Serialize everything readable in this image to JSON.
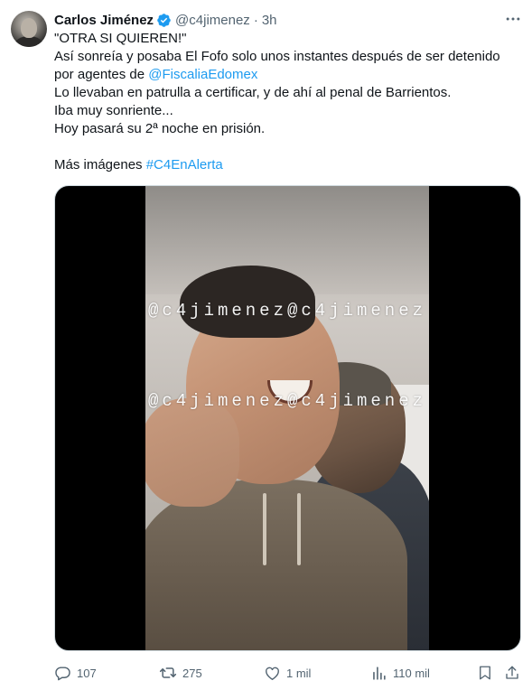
{
  "author": {
    "display_name": "Carlos Jiménez",
    "handle": "@c4jimenez",
    "separator": "·",
    "time": "3h",
    "verified_icon": "verified-badge-icon",
    "verified_color": "#1d9bf0"
  },
  "tweet": {
    "lines": [
      {
        "text": "\"OTRA SI QUIEREN!\""
      },
      {
        "text": "Así sonreía y posaba El Fofo solo unos instantes después de ser detenido"
      },
      {
        "prefix": "por agentes de ",
        "link": "@FiscaliaEdomex"
      },
      {
        "text": "Lo llevaban en patrulla a certificar, y de ahí al penal de Barrientos."
      },
      {
        "text": "Iba muy sonriente..."
      },
      {
        "text": "Hoy pasará su 2ª noche en prisión."
      },
      {
        "text": ""
      },
      {
        "prefix": "Más imágenes ",
        "link": "#C4EnAlerta"
      }
    ],
    "link_color": "#1d9bf0"
  },
  "media": {
    "watermarks": [
      "@c4jimenez@c4jimenez",
      "@c4jimenez@c4jimenez"
    ]
  },
  "actions": {
    "reply": {
      "icon": "reply-icon",
      "count": "107"
    },
    "retweet": {
      "icon": "retweet-icon",
      "count": "275"
    },
    "like": {
      "icon": "heart-icon",
      "count": "1 mil"
    },
    "views": {
      "icon": "views-chart-icon",
      "count": "110 mil"
    },
    "bookmark": {
      "icon": "bookmark-icon"
    },
    "share": {
      "icon": "share-icon"
    }
  },
  "colors": {
    "text_primary": "#0f1419",
    "text_secondary": "#536471",
    "accent": "#1d9bf0"
  }
}
